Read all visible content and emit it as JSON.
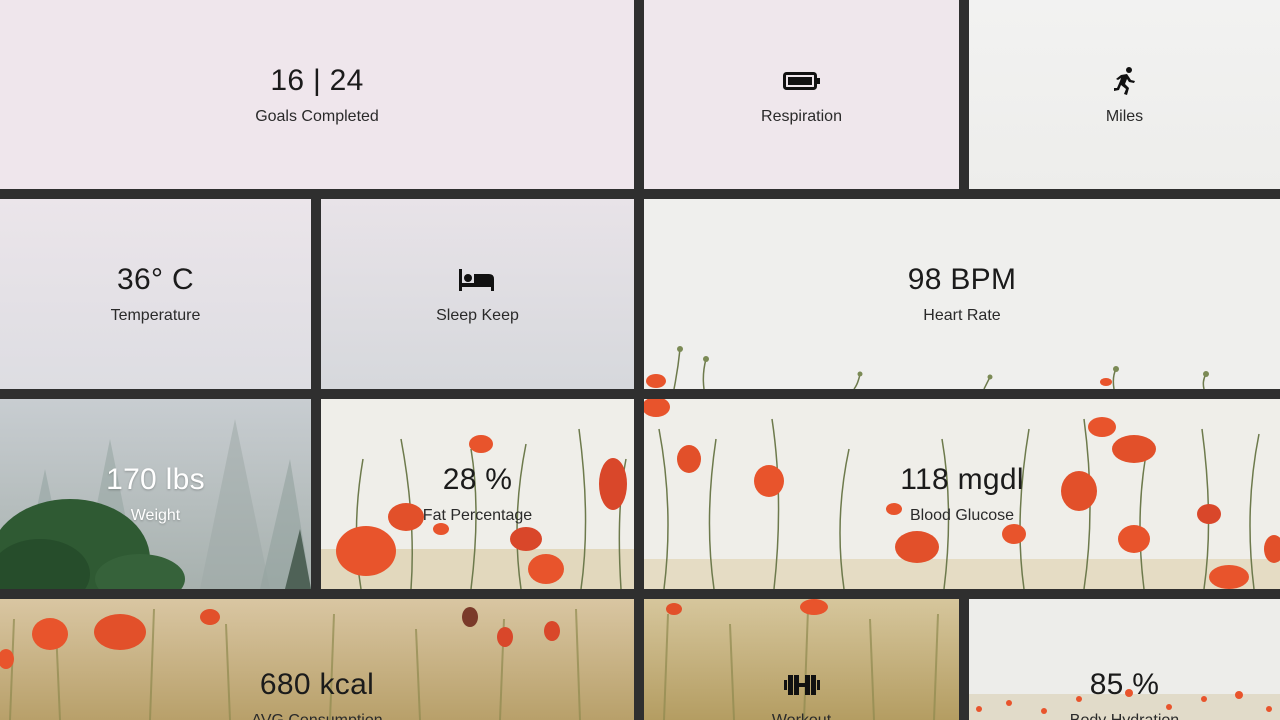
{
  "tiles": {
    "goals": {
      "value": "16 | 24",
      "label": "Goals Completed"
    },
    "respiration": {
      "label": "Respiration",
      "icon": "battery-icon"
    },
    "miles": {
      "label": "Miles",
      "icon": "running-icon"
    },
    "temperature": {
      "value": "36° C",
      "label": "Temperature"
    },
    "sleep": {
      "label": "Sleep Keep",
      "icon": "bed-icon"
    },
    "heart": {
      "value": "98 BPM",
      "label": "Heart Rate"
    },
    "weight": {
      "value": "170 lbs",
      "label": "Weight"
    },
    "fat": {
      "value": "28 %",
      "label": "Fat Percentage"
    },
    "glucose": {
      "value": "118 mgdl",
      "label": "Blood Glucose"
    },
    "kcal": {
      "value": "680 kcal",
      "label": "AVG Consumption"
    },
    "workout": {
      "label": "Workout",
      "icon": "dumbbell-icon"
    },
    "hydration": {
      "value": "85 %",
      "label": "Body Hydration"
    }
  },
  "colors": {
    "grid_gap": "#2f2f2f",
    "text_dark": "#1b1b1b",
    "text_light": "#ffffff",
    "poppy": "#e8542c"
  }
}
